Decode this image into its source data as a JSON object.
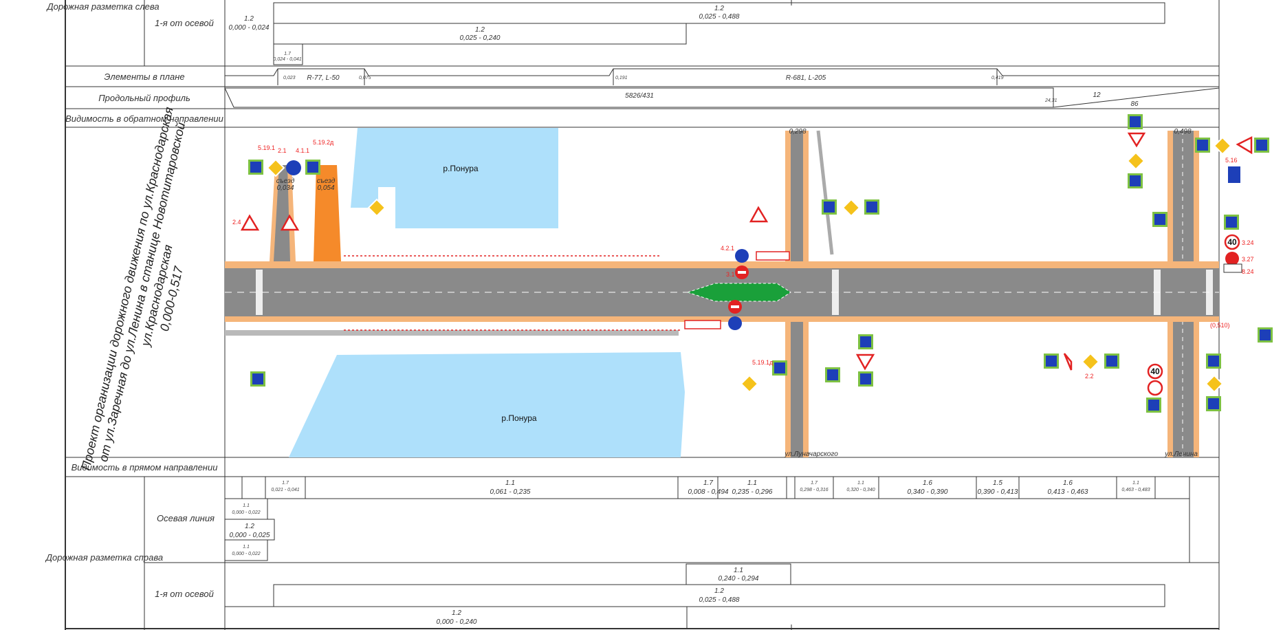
{
  "rows": {
    "left_marking": "Дорожная разметка слева",
    "first_from_axis": "1-я от осевой",
    "plan_elements": "Элементы в плане",
    "long_profile": "Продольный профиль",
    "visibility_back": "Видимость в обратном направлении",
    "visibility_forward": "Видимость в прямом направлении",
    "axis_line": "Осевая линия",
    "right_marking": "Дорожная разметка справа",
    "first_from_axis_bottom": "1-я от осевой"
  },
  "title_lines": [
    "Проект организации дорожного движения по ул.Краснодарская",
    "от ул.Заречная до ул.Ленина в станице Новотитаровской",
    "ул.Краснодарская",
    "0,000-0,517"
  ],
  "top_left_marks": [
    {
      "code": "1.2",
      "range": "0,025 - 0,488"
    },
    {
      "code": "1.2",
      "range": "0,000 - 0,024"
    },
    {
      "code": "1.2",
      "range": "0,025 - 0,240"
    },
    {
      "code": "1.7",
      "range": "0,024 - 0,041"
    }
  ],
  "plan_marks": [
    "0,023",
    "R-77, L-50",
    "0,075",
    "0,191",
    "R-681, L-205",
    "0,419"
  ],
  "profile_marks": [
    "5826/431",
    "24,31",
    "12",
    "86"
  ],
  "map_labels": {
    "river_top": "р.Понура",
    "river_bottom": "р.Понура",
    "street_lunacharskogo": "ул.Луначарского",
    "street_lenina": "ул.Ленина",
    "exit1": "съезд",
    "exit1_km": "0,034",
    "exit2": "съезд",
    "exit2_km": "0,054",
    "km_298": "0,298",
    "km_498": "0,498",
    "km_510": "(0,510)"
  },
  "sign_codes": [
    "5.19.1",
    "2.1",
    "4.1.1",
    "5.19.2д",
    "2.4",
    "5.16",
    "5.19.1д",
    "3.24",
    "3.27",
    "8.24",
    "2.2",
    "4.2.1",
    "3.1"
  ],
  "speed_limit": "40",
  "axis_marks": [
    {
      "code": "1.7",
      "range": "0,021 - 0,041"
    },
    {
      "code": "1.1",
      "range": "0,061 - 0,235"
    },
    {
      "code": "1.7",
      "range": "0,008 - 0,494"
    },
    {
      "code": "1.1",
      "range": "0,235 - 0,296"
    },
    {
      "code": "1.7",
      "range": "0,298 - 0,316"
    },
    {
      "code": "1.1",
      "range": "0,320 - 0,340"
    },
    {
      "code": "1.6",
      "range": "0,340 - 0,390"
    },
    {
      "code": "1.5",
      "range": "0,390 - 0,413"
    },
    {
      "code": "1.6",
      "range": "0,413 - 0,463"
    },
    {
      "code": "1.1",
      "range": "0,463 - 0,483"
    },
    {
      "code": "1.1",
      "range": "0,000 - 0,022"
    },
    {
      "code": "1.2",
      "range": "0,000 - 0,025"
    },
    {
      "code": "1.1",
      "range": "0,000 - 0,022"
    }
  ],
  "bottom_marks": [
    {
      "code": "1.1",
      "range": "0,240 - 0,294"
    },
    {
      "code": "1.2",
      "range": "0,025 - 0,488"
    },
    {
      "code": "1.2",
      "range": "0,000 - 0,240"
    }
  ],
  "colors": {
    "road": "#8a8a8a",
    "shoulder": "#f5b57a",
    "water": "#aee0fb",
    "sign_green": "#7dc142",
    "sign_blue": "#1d3fb8",
    "marking_red": "#e22222",
    "island": "#1aa03a"
  }
}
